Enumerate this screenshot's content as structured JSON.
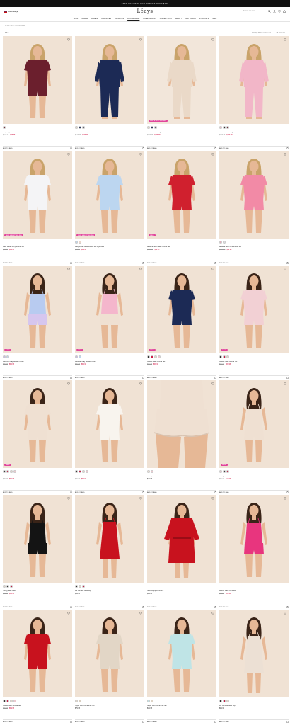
{
  "promo": {
    "text": "FREE DELIVERY FOR ORDERS OVER $100"
  },
  "header": {
    "region_label": "Australia ($)",
    "logo": "Léays",
    "search_placeholder": "Search our store"
  },
  "nav": {
    "items": [
      "SHOP",
      "NEW IN",
      "BRIDES",
      "CAMISOLES",
      "ULTIMATES",
      "LOUNGEWEAR",
      "ROBES/GOWNS",
      "COLLECTIONS",
      "BEAUTY",
      "GIFT CARDS",
      "STOCKISTS",
      "SALE"
    ],
    "active_index": 5
  },
  "breadcrumb": "HOME / ALL LOUNGEWEAR",
  "toolbar": {
    "filter_label": "Filter",
    "sort_label": "Sort by: Date, new to old",
    "count_label": "42 products"
  },
  "add_label": "ADD TO BAG",
  "products": [
    {
      "name": "Burgundy Stripe Satin Shorties",
      "old": "$109.95",
      "price": "$76.95",
      "badge": "",
      "swatches": [
        "#6a1f2c"
      ],
      "top": "#6b1f2d",
      "bottom": "#6b1f2d",
      "style": "short",
      "hair": "#c9a36a",
      "bg": "#f0e2d4"
    },
    {
      "name": "Classic Satin Long PJ Set",
      "old": "$179.95",
      "price": "$125.95",
      "badge": "",
      "swatches": [
        "#e2d6c6",
        "#1c2a55",
        "#5a5a66"
      ],
      "top": "#1c2a55",
      "bottom": "#1c2a55",
      "style": "long",
      "hair": "#c9a36a",
      "bg": "#f0e2d4"
    },
    {
      "name": "Classic Satin Long PJ Set",
      "old": "$179.95",
      "price": "$125.95",
      "badge": "NEW & BESTSELLING",
      "swatches": [
        "#e2d6c6",
        "#1c2a55",
        "#5a5a66"
      ],
      "top": "#ead9c8",
      "bottom": "#ead9c8",
      "style": "long",
      "hair": "#c9a36a",
      "bg": "#f2e6da"
    },
    {
      "name": "Classic Satin Long PJ Set",
      "old": "$179.95",
      "price": "$125.95",
      "badge": "",
      "swatches": [
        "#f0b9c6",
        "#1c1c1c",
        "#6a1f2c"
      ],
      "top": "#f2b6c8",
      "bottom": "#f2b6c8",
      "style": "long",
      "hair": "#c9a36a",
      "bg": "#f0e2d4"
    },
    {
      "name": "Baby Pastel Ivory Shortie Set",
      "old": "$99.95",
      "price": "$69.95",
      "badge": "NEW & BESTSELLING",
      "swatches": [],
      "top": "#f4f4f6",
      "bottom": "#f4f4f6",
      "style": "short",
      "hair": "#c9a36a",
      "bg": "#f0e2d4"
    },
    {
      "name": "Baby Pastel Satin Shortie Set Light Blue",
      "old": "$99.95",
      "price": "$69.95",
      "badge": "NEW & BESTSELLING",
      "swatches": [
        "#bcd6ee",
        "#f0d6c8"
      ],
      "top": "#bcd6f0",
      "bottom": "#bcd6f0",
      "style": "short",
      "hair": "#c9a36a",
      "bg": "#f0e2d4"
    },
    {
      "name": "Bestline Heart Satin Shortie Set",
      "old": "$109.95",
      "price": "$76.95",
      "badge": "SALE",
      "swatches": [],
      "top": "#d0202e",
      "bottom": "#d0202e",
      "style": "short",
      "hair": "#c9a36a",
      "bg": "#f0e2d4"
    },
    {
      "name": "Bestline Heart Knit Shortie Set",
      "old": "$109.95",
      "price": "$76.95",
      "badge": "",
      "swatches": [
        "#e8a8b8",
        "#ddd"
      ],
      "top": "#f28aa6",
      "bottom": "#f28aa6",
      "style": "short",
      "hair": "#c9a36a",
      "bg": "#f0e2d4"
    },
    {
      "name": "Lavender Day Blouse PJ Set",
      "old": "$89.95",
      "price": "$62.95",
      "badge": "SALE",
      "swatches": [
        "#c8b8e6",
        "#bcd6ee"
      ],
      "top": "#b8cbf0",
      "bottom": "#d6c6ee",
      "style": "cami",
      "hair": "#3a2418",
      "bg": "#f0e2d4"
    },
    {
      "name": "Lavender Day Blouse PJ Set",
      "old": "$89.95",
      "price": "$62.95",
      "badge": "SALE",
      "swatches": [
        "#c8b8e6",
        "#bcd6ee"
      ],
      "top": "#f4b6cc",
      "bottom": "#efe0d2",
      "style": "cami",
      "hair": "#3a2418",
      "bg": "#f0e2d4"
    },
    {
      "name": "Classic Satin Shortie Set",
      "old": "$99.95",
      "price": "$69.95",
      "badge": "SALE",
      "swatches": [
        "#1c1c1c",
        "#c03",
        "#e2d6c6",
        "#f0c8d0"
      ],
      "top": "#1c2a55",
      "bottom": "#1c2a55",
      "style": "short",
      "hair": "#3a2418",
      "bg": "#f0e2d4"
    },
    {
      "name": "Classic Satin Shortie Set",
      "old": "$99.95",
      "price": "$69.95",
      "badge": "SALE",
      "swatches": [
        "#1c1c1c",
        "#c03",
        "#e2d6c6"
      ],
      "top": "#f2d0d4",
      "bottom": "#f2d0d4",
      "style": "short",
      "hair": "#3a2418",
      "bg": "#f0e2d4"
    },
    {
      "name": "Classic Satin Shortie Set",
      "old": "$99.95",
      "price": "$69.95",
      "badge": "SALE",
      "swatches": [
        "#1c1c1c",
        "#c03",
        "#e2d6c6",
        "#f0c8d0"
      ],
      "top": "#efe0d2",
      "bottom": "#efe0d2",
      "style": "short",
      "hair": "#3a2418",
      "bg": "#f0e2d4"
    },
    {
      "name": "Classic Satin Shortie Set",
      "old": "$99.95",
      "price": "$69.95",
      "badge": "",
      "swatches": [
        "#1c1c1c",
        "#c03",
        "#e2d6c6",
        "#f0c8d0"
      ],
      "top": "#f8f4ee",
      "bottom": "#f8f4ee",
      "style": "short",
      "hair": "#3a2418",
      "bg": "#f0e2d4"
    },
    {
      "name": "Young Satin Short",
      "old": "",
      "price": "$49.95",
      "badge": "",
      "swatches": [
        "#efe0d2",
        "#f0c8d0"
      ],
      "top": "#efe0d2",
      "bottom": "#efe0d2",
      "style": "crop",
      "hair": "#3a2418",
      "bg": "#f0e2d4"
    },
    {
      "name": "Young Satin Cami",
      "old": "$59.95",
      "price": "$41.95",
      "badge": "SALE",
      "swatches": [
        "#f0c8d0",
        "#1c1c1c",
        "#c03"
      ],
      "top": "#efe0d2",
      "bottom": "#efe0d2",
      "style": "cami",
      "hair": "#3a2418",
      "bg": "#f0e2d4"
    },
    {
      "name": "Young Satin Cami",
      "old": "$59.95",
      "price": "$41.95",
      "badge": "",
      "swatches": [
        "#e2d6c6",
        "#1c1c1c",
        "#c03"
      ],
      "top": "#141414",
      "bottom": "#141414",
      "style": "cami",
      "hair": "#3a2418",
      "bg": "#f0e2d4"
    },
    {
      "name": "Mo Ultimate Satin Slip",
      "old": "",
      "price": "$99.95",
      "badge": "",
      "swatches": [
        "#1c1c1c",
        "#e2d6c6",
        "#c03"
      ],
      "top": "#c8121e",
      "bottom": "#c8121e",
      "style": "slip",
      "hair": "#3a2418",
      "bg": "#f0e2d4"
    },
    {
      "name": "Satin Cropped Kimono",
      "old": "",
      "price": "$69.95",
      "badge": "",
      "swatches": [],
      "top": "#c8121e",
      "bottom": "#c8121e",
      "style": "robe",
      "hair": "#3a2418",
      "bg": "#f0e2d4"
    },
    {
      "name": "Deluxe Satin Cami Set",
      "old": "$79.95",
      "price": "$55.95",
      "badge": "",
      "swatches": [],
      "top": "#e8357e",
      "bottom": "#e8357e",
      "style": "cami",
      "hair": "#3a2418",
      "bg": "#f0e2d4"
    },
    {
      "name": "Classic Satin Shortie Set",
      "old": "$99.95",
      "price": "$69.95",
      "badge": "",
      "swatches": [
        "#1c1c1c",
        "#c03",
        "#e2d6c6",
        "#f0c8d0"
      ],
      "top": "#c8121e",
      "bottom": "#c8121e",
      "style": "short",
      "hair": "#3a2418",
      "bg": "#f0e2d4"
    },
    {
      "name": "Super Soft Knit Shortie Set",
      "old": "",
      "price": "$79.95",
      "badge": "",
      "swatches": [
        "#e2d6c6",
        "#dcd0c0"
      ],
      "top": "#e2d6c6",
      "bottom": "#e2d6c6",
      "style": "short",
      "hair": "#3a2418",
      "bg": "#f0e2d4"
    },
    {
      "name": "Super Soft Knit Shortie Set",
      "old": "",
      "price": "$79.95",
      "badge": "",
      "swatches": [
        "#bfe4e6",
        "#e2d6c6"
      ],
      "top": "#bfe4e6",
      "bottom": "#bfe4e6",
      "style": "short",
      "hair": "#3a2418",
      "bg": "#f0e2d4"
    },
    {
      "name": "Mo Ultimate Satin Slip",
      "old": "",
      "price": "$99.95",
      "badge": "",
      "swatches": [
        "#1c1c1c",
        "#c03",
        "#e2d6c6"
      ],
      "top": "#ece0d4",
      "bottom": "#ece0d4",
      "style": "slip",
      "hair": "#3a2418",
      "bg": "#f0e2d4"
    }
  ]
}
